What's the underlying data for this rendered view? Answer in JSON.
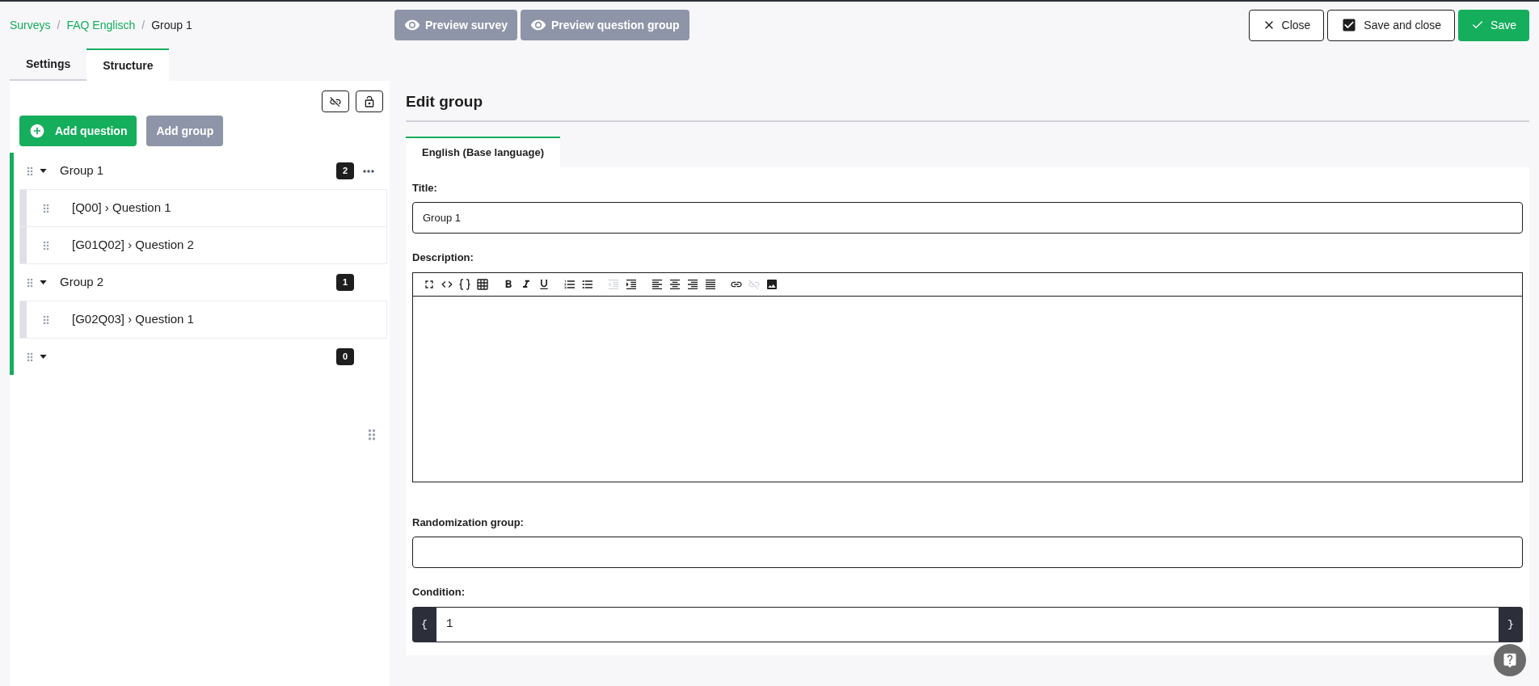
{
  "breadcrumb_separator": "/",
  "breadcrumbs": [
    {
      "label": "Surveys",
      "kind": "link"
    },
    {
      "label": "FAQ Englisch",
      "kind": "link"
    },
    {
      "label": "Group 1",
      "kind": "current"
    }
  ],
  "preview_buttons": [
    "Preview survey",
    "Preview question group"
  ],
  "action_buttons": [
    {
      "label": "Close",
      "kind": "close"
    },
    {
      "label": "Save and close",
      "kind": "save_close"
    },
    {
      "label": "Save",
      "kind": "save"
    }
  ],
  "tabs": [
    {
      "label": "Settings",
      "selected": false
    },
    {
      "label": "Structure",
      "selected": true
    }
  ],
  "structure": {
    "add_question": "Add question",
    "add_group": "Add group",
    "groups": [
      {
        "title": "Group 1",
        "count": "2",
        "expanded": true,
        "hovered": true,
        "children": [
          {
            "title": "[Q00] › Question 1"
          },
          {
            "title": "[G01Q02] › Question 2"
          }
        ]
      },
      {
        "title": "Group 2",
        "count": "1",
        "expanded": true,
        "hovered": false,
        "children": [
          {
            "title": "[G02Q03] › Question 1"
          }
        ]
      },
      {
        "count": "0",
        "expanded": true,
        "hovered": false
      }
    ]
  },
  "editor": {
    "heading": "Edit group",
    "language_tabs": [
      {
        "label": "English (Base language)",
        "selected": true
      }
    ],
    "title_label": "Title:",
    "title_value": "Group 1",
    "description_label": "Description:",
    "toolbar": [
      {
        "kind": "fullscreen",
        "disabled": false
      },
      {
        "kind": "source",
        "disabled": false
      },
      {
        "kind": "braces",
        "disabled": false
      },
      {
        "kind": "table",
        "disabled": false
      },
      {
        "kind": "bold",
        "disabled": false
      },
      {
        "kind": "italic",
        "disabled": false
      },
      {
        "kind": "underline",
        "disabled": false
      },
      {
        "kind": "numbered",
        "disabled": false
      },
      {
        "kind": "bulleted",
        "disabled": false
      },
      {
        "kind": "outdent",
        "disabled": true
      },
      {
        "kind": "indent",
        "disabled": false
      },
      {
        "kind": "align_left",
        "disabled": false
      },
      {
        "kind": "align_center",
        "disabled": false
      },
      {
        "kind": "align_right",
        "disabled": false
      },
      {
        "kind": "justify",
        "disabled": false
      },
      {
        "kind": "link",
        "disabled": false
      },
      {
        "kind": "unlink",
        "disabled": true
      },
      {
        "kind": "image",
        "disabled": false
      }
    ],
    "randomization_label": "Randomization group:",
    "condition_label": "Condition:",
    "condition_open": "{",
    "condition_value": "1",
    "condition_close": "}"
  }
}
